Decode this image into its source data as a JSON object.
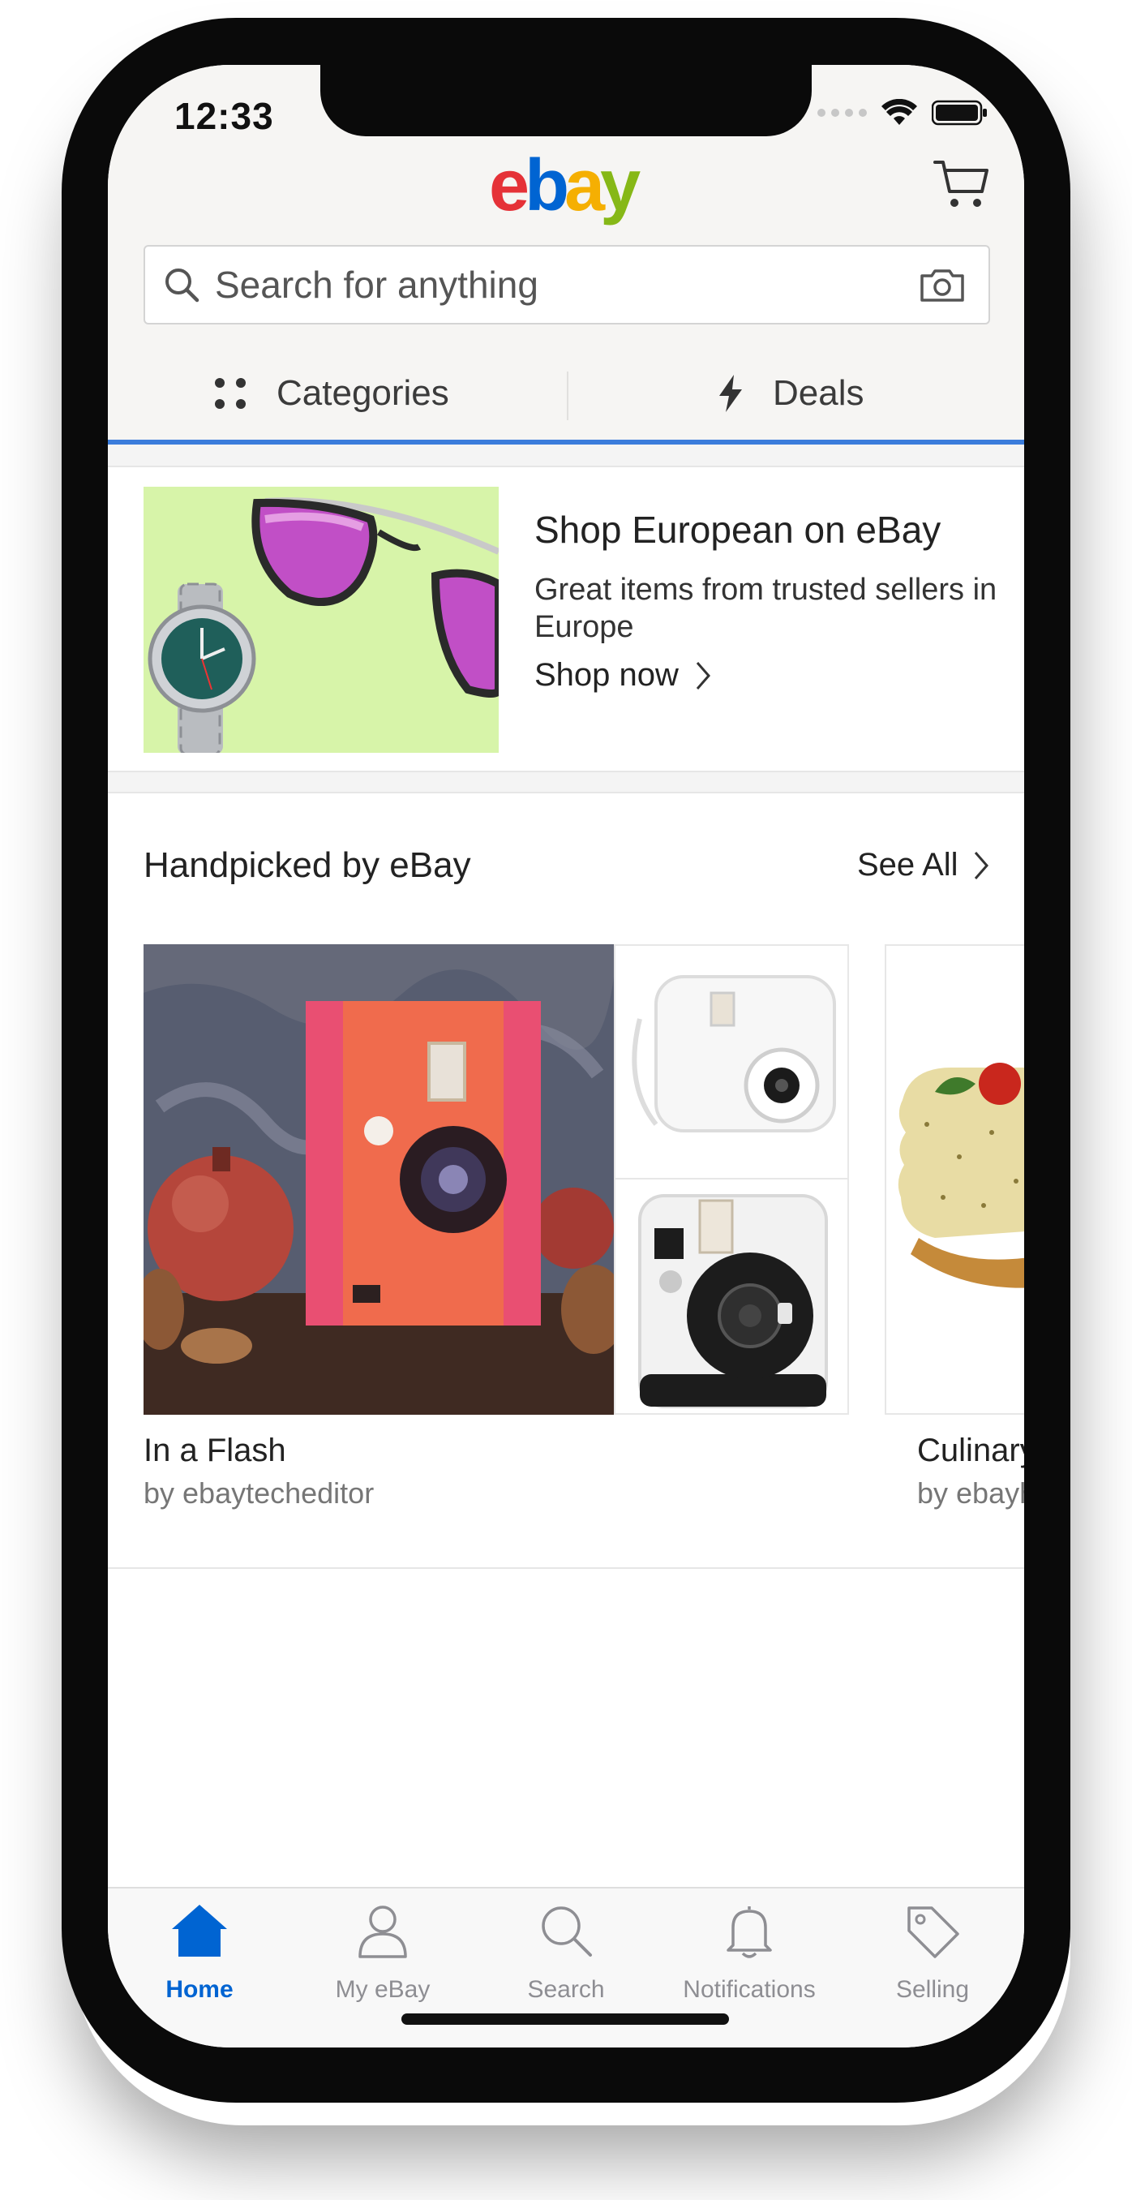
{
  "status_bar": {
    "time": "12:33"
  },
  "header": {
    "logo": {
      "e": "e",
      "b": "b",
      "a": "a",
      "y": "y"
    },
    "search": {
      "placeholder": "Search for anything"
    },
    "nav": {
      "categories": "Categories",
      "deals": "Deals"
    }
  },
  "promo": {
    "title": "Shop European on eBay",
    "subtitle": "Great items from trusted sellers in Europe",
    "link": "Shop now"
  },
  "handpicked": {
    "title": "Handpicked by eBay",
    "see_all": "See All",
    "collections": [
      {
        "title": "In a Flash",
        "by": "by ebaytecheditor"
      },
      {
        "title": "Culinary C",
        "by": "by ebayho"
      }
    ]
  },
  "tabbar": {
    "tabs": [
      {
        "label": "Home",
        "icon": "home-icon",
        "active": true
      },
      {
        "label": "My eBay",
        "icon": "person-icon",
        "active": false
      },
      {
        "label": "Search",
        "icon": "search-icon",
        "active": false
      },
      {
        "label": "Notifications",
        "icon": "bell-icon",
        "active": false
      },
      {
        "label": "Selling",
        "icon": "tag-icon",
        "active": false
      }
    ]
  },
  "colors": {
    "accent_blue": "#0064d2",
    "header_background": "#f6f5f3",
    "active_tab_indicator": "#3a7cdb",
    "logo_e": "#e53238",
    "logo_b": "#0064d2",
    "logo_a": "#f5af02",
    "logo_y": "#86b817"
  }
}
